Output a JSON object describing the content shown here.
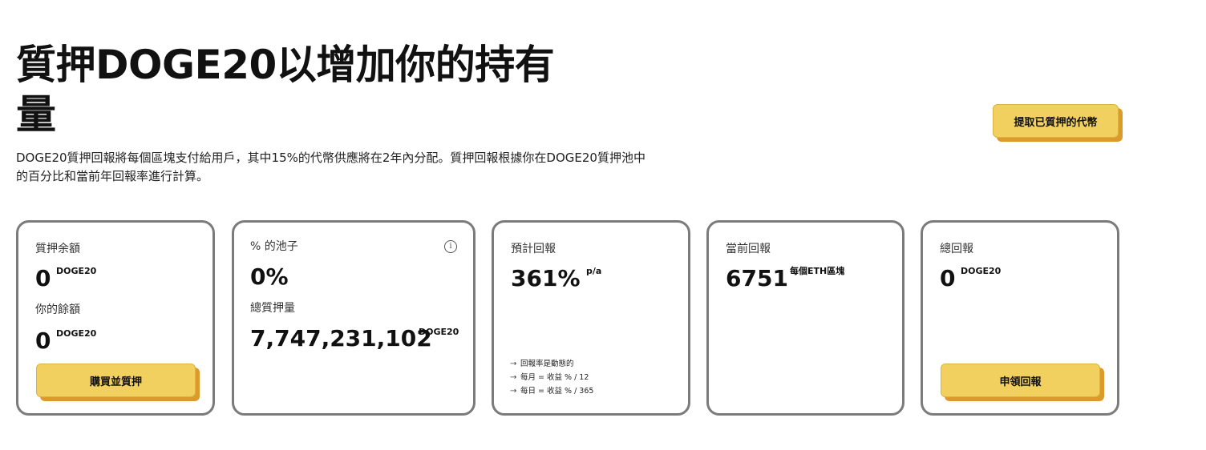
{
  "hero": {
    "title": "質押DOGE20以增加你的持有量",
    "description": "DOGE20質押回報將每個區塊支付給用戶，其中15%的代幣供應將在2年內分配。質押回報根據你在DOGE20質押池中的百分比和當前年回報率進行計算。",
    "withdraw_label": "提取已質押的代幣"
  },
  "cards": {
    "staked": {
      "label": "質押余額",
      "value": "0",
      "unit": "DOGE20",
      "balance_label": "你的餘額",
      "balance_value": "0",
      "balance_unit": "DOGE20",
      "button_label": "購買並質押"
    },
    "pool": {
      "label": "% 的池子",
      "info_icon": "i",
      "value": "0%",
      "total_label": "總質押量",
      "total_value": "7,747,231,102",
      "total_unit": "DOGE20"
    },
    "estimated": {
      "label": "預計回報",
      "value": "361%",
      "unit": "p/a",
      "notes": [
        "回報率是動態的",
        "每月 = 收益 % / 12",
        "每日 = 收益 % / 365"
      ]
    },
    "current": {
      "label": "當前回報",
      "value": "6751",
      "unit": "每個ETH區塊"
    },
    "total": {
      "label": "總回報",
      "value": "0",
      "unit": "DOGE20",
      "button_label": "申領回報"
    }
  },
  "colors": {
    "button_bg": "#f2d060",
    "button_shadow": "#dd9a2c",
    "card_border": "#7b7b7b",
    "text": "#111111"
  }
}
